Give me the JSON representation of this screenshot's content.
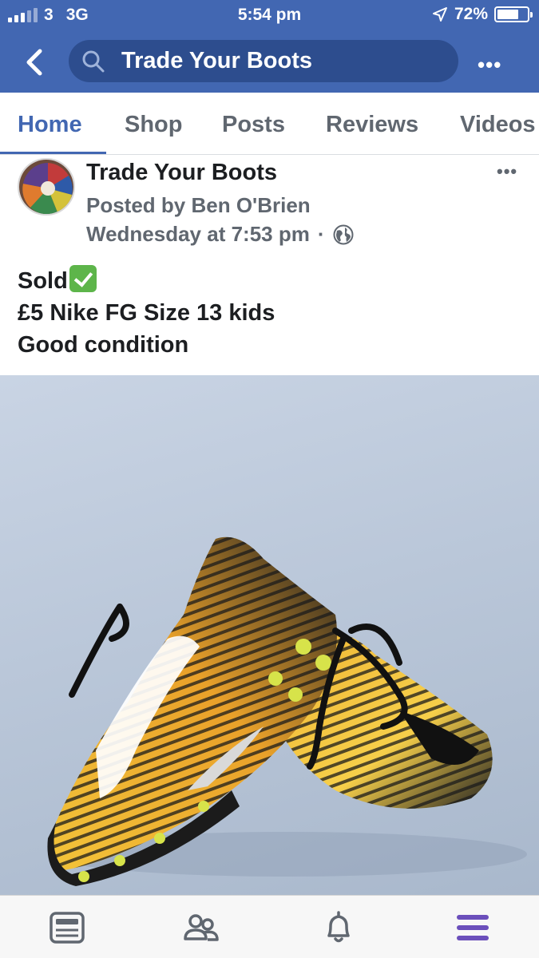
{
  "status_bar": {
    "carrier": "3",
    "network": "3G",
    "time": "5:54 pm",
    "battery_percent": "72%",
    "battery_level": 0.72
  },
  "header": {
    "search_text": "Trade Your Boots"
  },
  "tabs": [
    {
      "label": "Home",
      "active": true
    },
    {
      "label": "Shop",
      "active": false
    },
    {
      "label": "Posts",
      "active": false
    },
    {
      "label": "Reviews",
      "active": false
    },
    {
      "label": "Videos",
      "active": false
    }
  ],
  "post": {
    "page_name": "Trade Your Boots",
    "posted_by": "Posted by Ben O'Brien",
    "timestamp": "Wednesday at 7:53 pm",
    "separator": "·",
    "privacy_icon": "globe-icon",
    "lines": [
      "Sold",
      "£5 Nike FG Size 13 kids",
      "Good condition"
    ],
    "sold_emoji": "check-mark-button-icon",
    "photo_subject": "yellow and black football boots"
  },
  "bottom_nav": [
    {
      "icon": "news-feed-icon",
      "active": false
    },
    {
      "icon": "groups-icon",
      "active": false
    },
    {
      "icon": "notifications-bell-icon",
      "active": false
    },
    {
      "icon": "menu-icon",
      "active": true
    }
  ],
  "colors": {
    "brand_blue": "#4267b2",
    "search_bg": "#2d4d8e",
    "active_menu": "#6b4fbb"
  }
}
